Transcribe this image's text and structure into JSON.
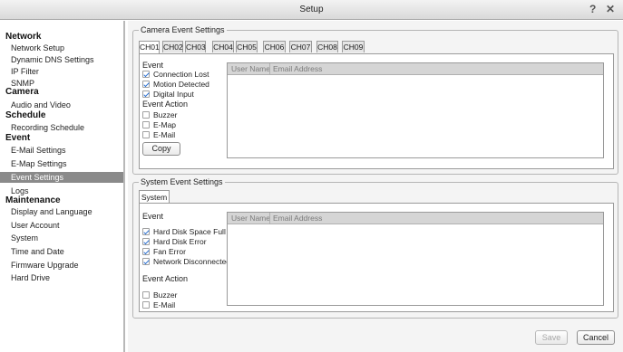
{
  "window": {
    "title": "Setup",
    "help_glyph": "?",
    "close_glyph": "✕"
  },
  "sidebar": {
    "sections": [
      {
        "header": "Network",
        "items": [
          "Network Setup",
          "Dynamic DNS Settings",
          "IP Filter",
          "SNMP"
        ]
      },
      {
        "header": "Camera",
        "items": [
          "Audio and Video"
        ]
      },
      {
        "header": "Schedule",
        "items": [
          "Recording Schedule"
        ]
      },
      {
        "header": "Event",
        "items": [
          "E-Mail Settings",
          "E-Map Settings",
          "Event Settings",
          "Logs"
        ]
      },
      {
        "header": "Maintenance",
        "items": [
          "Display and Language",
          "User Account",
          "System",
          "Time and Date",
          "Firmware Upgrade",
          "Hard Drive"
        ]
      }
    ],
    "active_item": "Event Settings"
  },
  "camera_event": {
    "legend": "Camera Event Settings",
    "tabs": [
      "CH01",
      "CH02",
      "CH03",
      "CH04",
      "CH05",
      "CH06",
      "CH07",
      "CH08",
      "CH09"
    ],
    "active_tab": "CH01",
    "event_label": "Event",
    "events": [
      {
        "label": "Connection Lost",
        "checked": true
      },
      {
        "label": "Motion Detected",
        "checked": true
      },
      {
        "label": "Digital Input",
        "checked": true
      }
    ],
    "action_label": "Event Action",
    "actions": [
      {
        "label": "Buzzer",
        "checked": false
      },
      {
        "label": "E-Map",
        "checked": false
      },
      {
        "label": "E-Mail",
        "checked": false
      }
    ],
    "copy_button": "Copy",
    "table": {
      "col_user": "User Name",
      "col_email": "Email Address"
    }
  },
  "system_event": {
    "legend": "System Event Settings",
    "tab": "System",
    "event_label": "Event",
    "events": [
      {
        "label": "Hard Disk Space Full",
        "checked": true
      },
      {
        "label": "Hard Disk Error",
        "checked": true
      },
      {
        "label": "Fan Error",
        "checked": true
      },
      {
        "label": "Network Disconnected",
        "checked": true
      }
    ],
    "action_label": "Event Action",
    "actions": [
      {
        "label": "Buzzer",
        "checked": false
      },
      {
        "label": "E-Mail",
        "checked": false
      }
    ],
    "table": {
      "col_user": "User Name",
      "col_email": "Email Address"
    }
  },
  "footer": {
    "save": "Save",
    "cancel": "Cancel"
  },
  "colors": {
    "active_item_bg": "#8a8a8a",
    "check_blue": "#2a6fd1"
  }
}
